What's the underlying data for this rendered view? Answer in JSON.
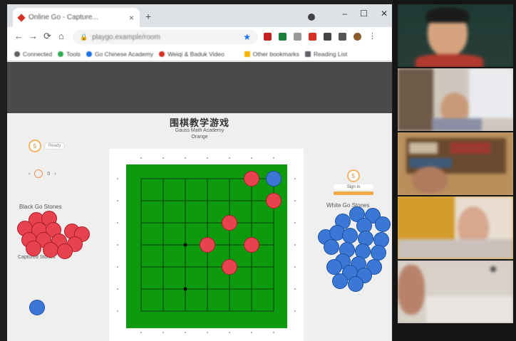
{
  "browser": {
    "tab_title": "Online Go - Capture...",
    "tab_close": "×",
    "new_tab": "+",
    "window_controls": [
      "–",
      "☐",
      "✕"
    ],
    "nav_buttons": [
      "←",
      "→",
      "⟳",
      "⌂"
    ],
    "url": "playgo.example/room",
    "bookmarks": [
      {
        "label": "Connected",
        "color": "#5f6368"
      },
      {
        "label": "Tools",
        "color": "#34a853"
      },
      {
        "label": "Go Chinese Academy",
        "color": "#1a73e8"
      },
      {
        "label": "Weiqi & Baduk Video",
        "color": "#d93025"
      },
      {
        "label": "Other bookmarks",
        "color": "#f4b400"
      },
      {
        "label": "Reading List",
        "color": "#5f6368"
      }
    ]
  },
  "game": {
    "title": "围棋教学游戏",
    "subtitle_line1": "Gauss Math Academy",
    "subtitle_line2": "Orange",
    "left_timer": "5",
    "left_timer_pill": "Ready",
    "left_counter": "0",
    "black_label": "Black Go Stones",
    "captured_label": "Captured Stones",
    "white_label": "White Go Stones",
    "right_timer": "5",
    "right_status": "Sign in"
  },
  "board": {
    "size": 7,
    "star_points": [
      [
        2,
        3
      ],
      [
        2,
        5
      ]
    ],
    "red_stones": [
      [
        5,
        0
      ],
      [
        6,
        1
      ],
      [
        4,
        2
      ],
      [
        3,
        3
      ],
      [
        5,
        3
      ],
      [
        4,
        4
      ]
    ],
    "blue_stones": [
      [
        6,
        0
      ]
    ]
  },
  "colors": {
    "board_green": "#0e9a0e",
    "red_stone": "#e8424e",
    "blue_stone": "#3b78d6",
    "banner": "#4a4a4a"
  },
  "video_participants": [
    "host",
    "participant-2",
    "participant-3",
    "participant-4",
    "participant-5"
  ]
}
